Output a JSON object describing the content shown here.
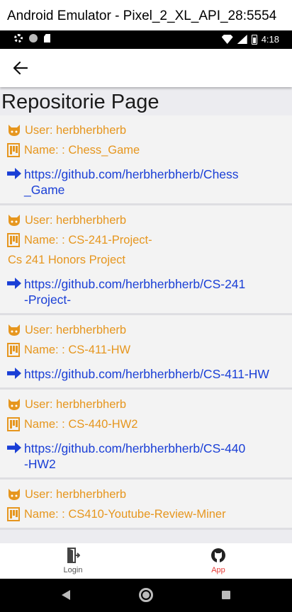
{
  "window": {
    "title": "Android Emulator - Pixel_2_XL_API_28:5554"
  },
  "statusbar": {
    "time": "4:18"
  },
  "appbar": {
    "back_icon": "arrow-left-icon"
  },
  "page": {
    "title": "Repositorie Page"
  },
  "repos": [
    {
      "user": "User: herbherbherb",
      "name": "Name: : Chess_Game",
      "description": "",
      "url": "https://github.com/herbherbherb/Chess_Game",
      "url_line1": "https://github.com/herbherbherb/Chess",
      "url_line2": "_Game"
    },
    {
      "user": "User: herbherbherb",
      "name": "Name: : CS-241-Project-",
      "description": "Cs 241 Honors Project",
      "url": "https://github.com/herbherbherb/CS-241-Project-",
      "url_line1": "https://github.com/herbherbherb/CS-241",
      "url_line2": "-Project-"
    },
    {
      "user": "User: herbherbherb",
      "name": "Name: : CS-411-HW",
      "description": "",
      "url": "https://github.com/herbherbherb/CS-411-HW",
      "url_line1": "https://github.com/herbherbherb/CS-411-HW",
      "url_line2": ""
    },
    {
      "user": "User: herbherbherb",
      "name": "Name: : CS-440-HW2",
      "description": "",
      "url": "https://github.com/herbherbherb/CS-440-HW2",
      "url_line1": "https://github.com/herbherbherb/CS-440",
      "url_line2": "-HW2"
    },
    {
      "user": "User: herbherbherb",
      "name": "Name: : CS410-Youtube-Review-Miner",
      "description": "",
      "url": "",
      "url_line1": "",
      "url_line2": ""
    }
  ],
  "bottom_nav": {
    "items": [
      {
        "label": "Login",
        "icon": "login-door-icon",
        "active": false
      },
      {
        "label": "App",
        "icon": "github-icon",
        "active": true
      }
    ]
  },
  "colors": {
    "accent_orange": "#e6961e",
    "link_blue": "#1a3fd6",
    "active_red": "#e53935"
  }
}
